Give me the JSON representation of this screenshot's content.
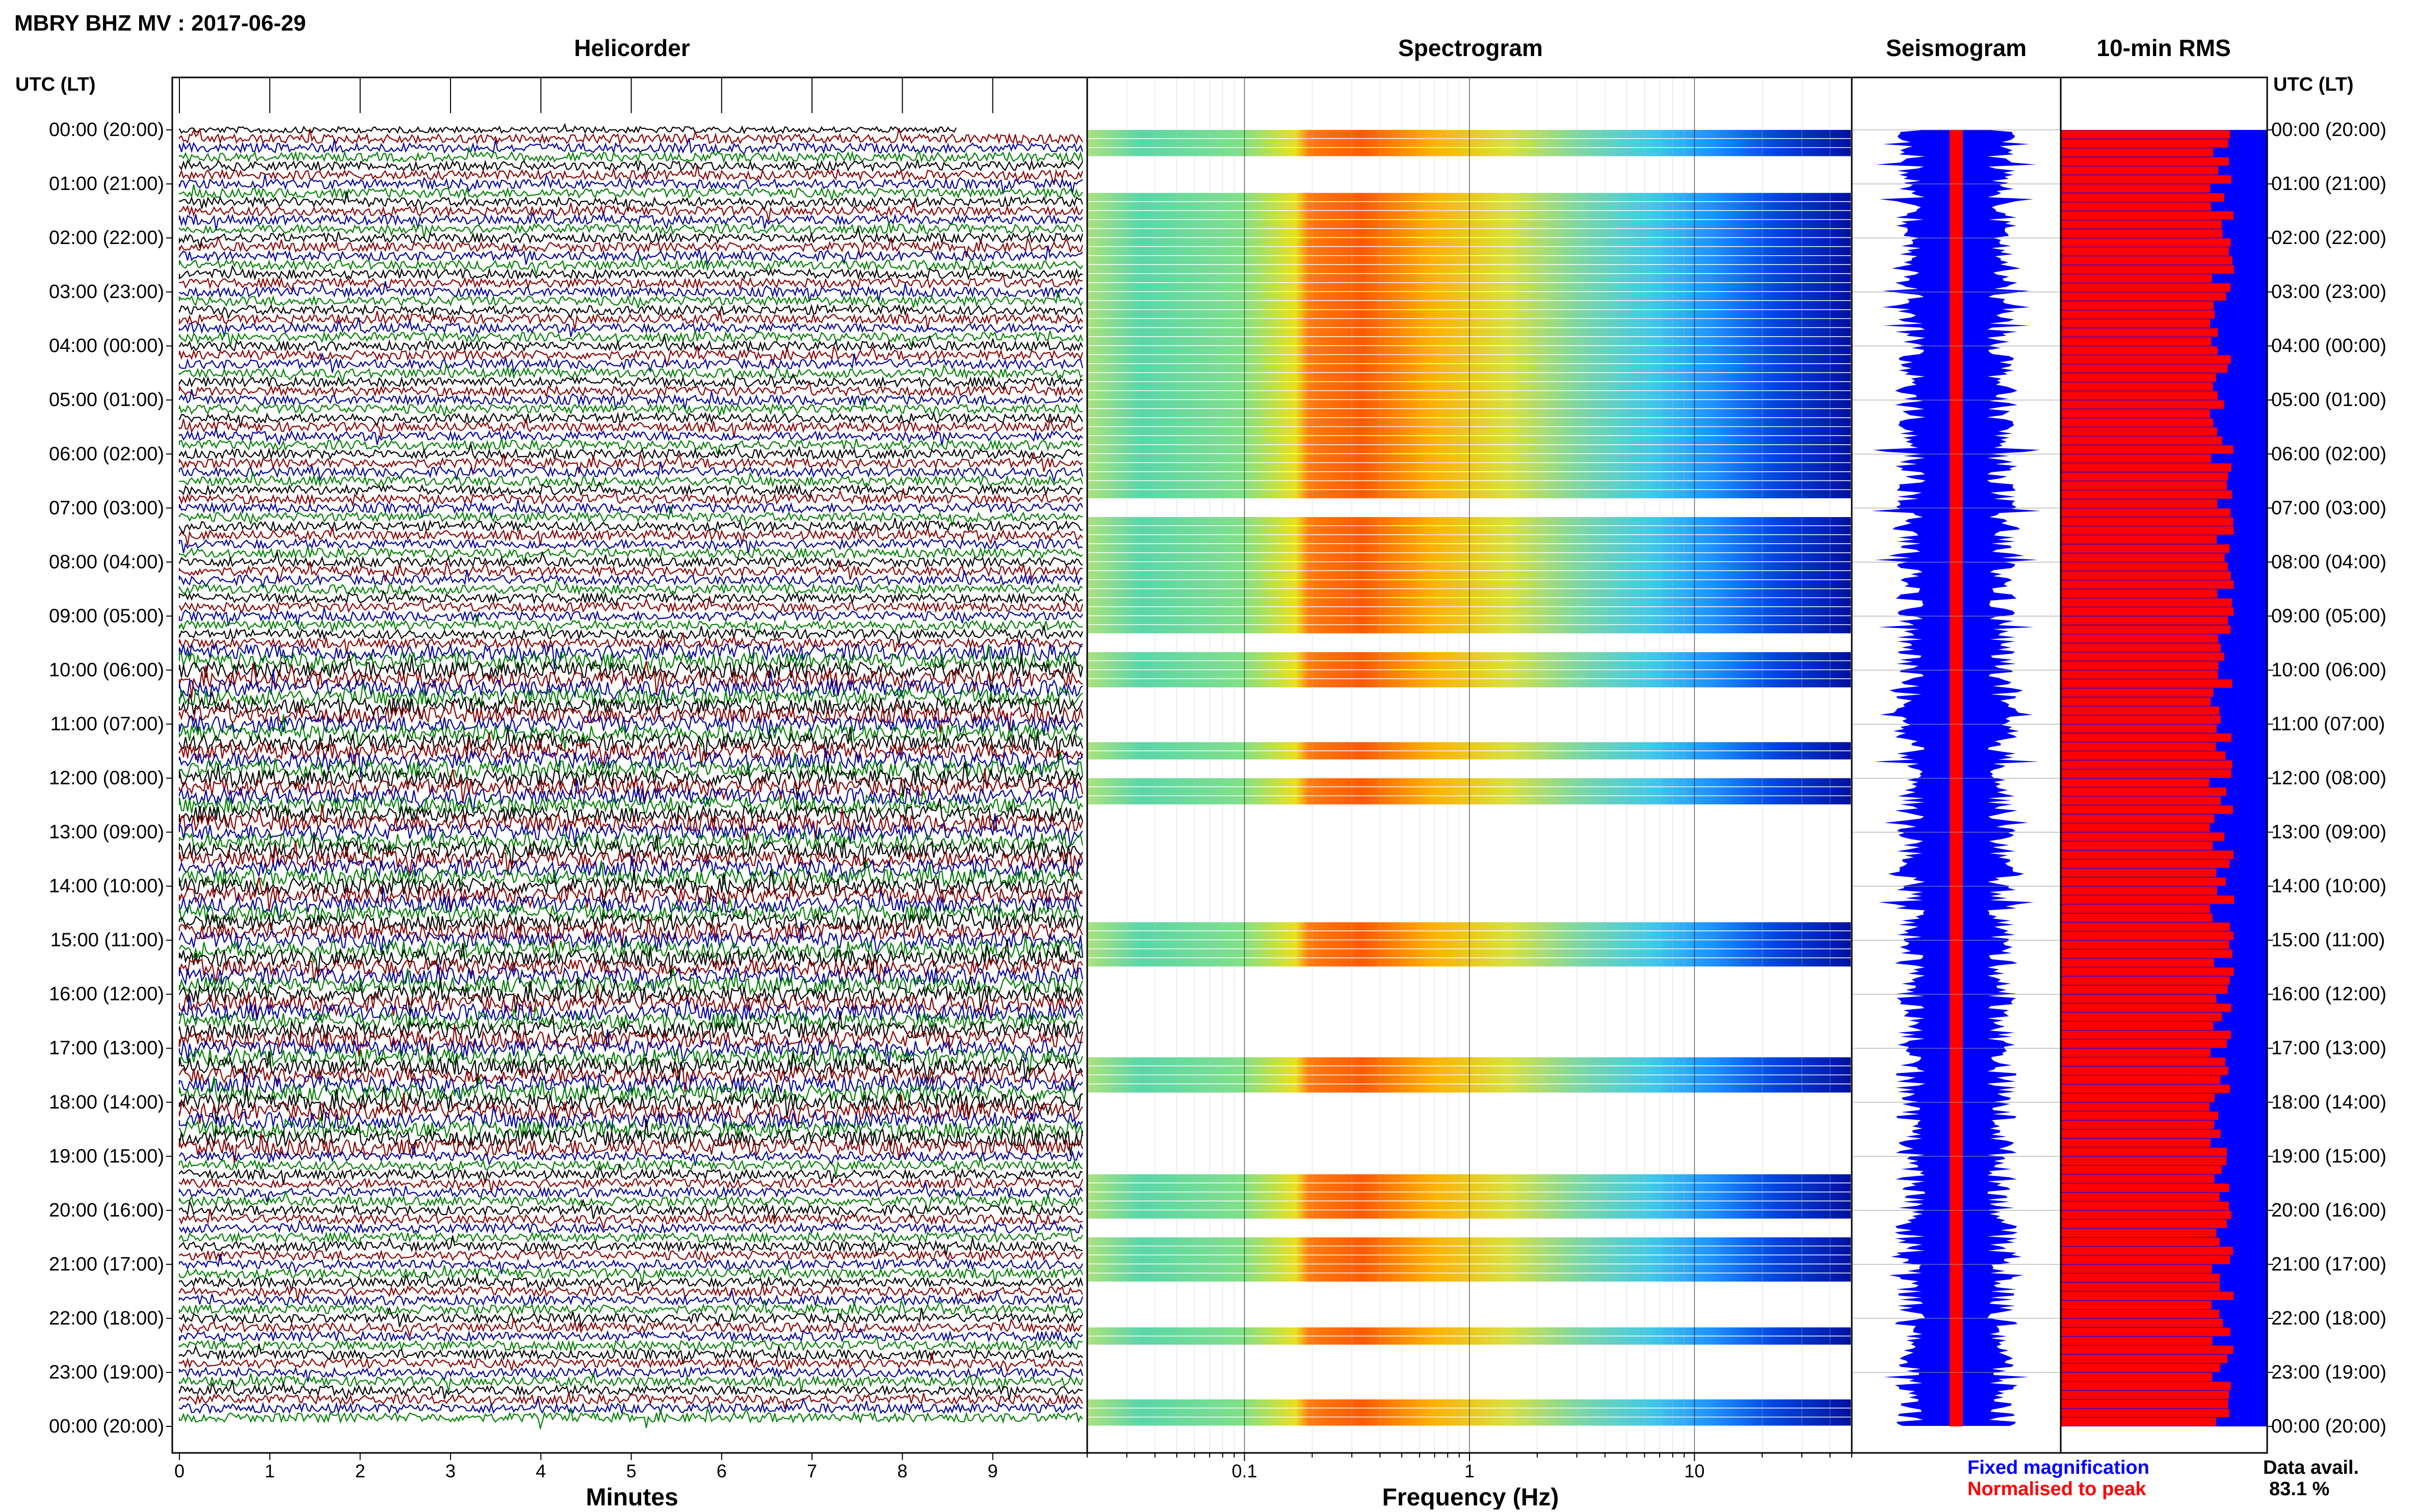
{
  "header": {
    "title": "MBRY BHZ MV : 2017-06-29",
    "utc_label_left": "UTC (LT)",
    "utc_label_right": "UTC (LT)"
  },
  "panels": {
    "helicorder_title": "Helicorder",
    "spectrogram_title": "Spectrogram",
    "seismogram_title": "Seismogram",
    "rms_title": "10-min RMS"
  },
  "legend": {
    "fixed": "Fixed magnification",
    "normalised": "Normalised to peak",
    "fixed_color": "#0000ff",
    "normalised_color": "#ff0000"
  },
  "availability": {
    "label": "Data avail.",
    "value": "83.1 %"
  },
  "chart_data": [
    {
      "type": "line",
      "panel": "Helicorder",
      "title": "Helicorder",
      "xlabel": "Minutes",
      "x_ticks": [
        "0",
        "1",
        "2",
        "3",
        "4",
        "5",
        "6",
        "7",
        "8",
        "9"
      ],
      "xlim": [
        0,
        10
      ],
      "trace_colors": [
        "#000000",
        "#8b0000",
        "#0000a0",
        "#008000"
      ],
      "hour_labels": [
        "00:00 (20:00)",
        "01:00 (21:00)",
        "02:00 (22:00)",
        "03:00 (23:00)",
        "04:00 (00:00)",
        "05:00 (01:00)",
        "06:00 (02:00)",
        "07:00 (03:00)",
        "08:00 (04:00)",
        "09:00 (05:00)",
        "10:00 (06:00)",
        "11:00 (07:00)",
        "12:00 (08:00)",
        "13:00 (09:00)",
        "14:00 (10:00)",
        "15:00 (11:00)",
        "16:00 (12:00)",
        "17:00 (13:00)",
        "18:00 (14:00)",
        "19:00 (15:00)",
        "20:00 (16:00)",
        "21:00 (17:00)",
        "22:00 (18:00)",
        "23:00 (19:00)",
        "00:00 (20:00)"
      ]
    },
    {
      "type": "heatmap",
      "panel": "Spectrogram",
      "title": "Spectrogram",
      "xlabel": "Frequency (Hz)",
      "x_scale": "log",
      "x_ticks": [
        "0.1",
        "1",
        "10"
      ],
      "xlim": [
        0.02,
        50
      ],
      "colormap": "jet"
    },
    {
      "type": "line",
      "panel": "Seismogram",
      "title": "Seismogram",
      "series": [
        {
          "name": "Fixed magnification",
          "color": "#0000ff"
        },
        {
          "name": "Normalised to peak",
          "color": "#ff0000"
        }
      ]
    },
    {
      "type": "bar",
      "panel": "10-min RMS",
      "title": "10-min RMS",
      "orientation": "horizontal",
      "series": [
        {
          "name": "Fixed magnification",
          "color": "#0000ff"
        },
        {
          "name": "Normalised to peak",
          "color": "#ff0000"
        }
      ]
    }
  ]
}
